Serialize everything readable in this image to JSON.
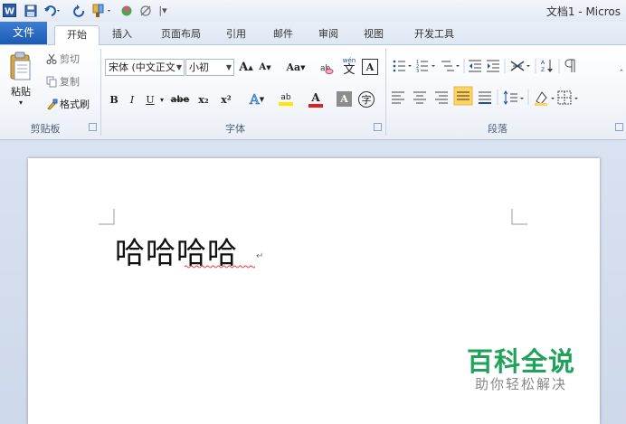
{
  "window": {
    "title": "文档1 - Micros"
  },
  "tabs": [
    "文件",
    "开始",
    "插入",
    "页面布局",
    "引用",
    "邮件",
    "审阅",
    "视图",
    "开发工具"
  ],
  "clipboard": {
    "paste_label": "粘贴",
    "cut_label": "剪切",
    "copy_label": "复制",
    "format_painter_label": "格式刷",
    "group_label": "剪贴板"
  },
  "font": {
    "font_name": "宋体 (中文正文",
    "font_size": "小初",
    "grow": "A",
    "shrink": "A",
    "change_case": "Aa",
    "clear_format": "☢",
    "pinyin": "wén",
    "bold": "B",
    "italic": "I",
    "underline": "U",
    "strikethrough": "abe",
    "subscript": "x₂",
    "superscript": "x²",
    "text_effect": "A",
    "highlight": "ab",
    "font_color": "A",
    "char_shading": "A",
    "enclose": "字",
    "group_label": "字体"
  },
  "paragraph": {
    "group_label": "段落"
  },
  "document": {
    "text": "哈哈哈哈"
  },
  "watermark": {
    "main": "百科全说",
    "sub": "助你轻松解决"
  },
  "colors": {
    "file_tab": "#2a6cc4",
    "watermark_green": "#1fa35b",
    "highlight_yellow": "#ffd35e",
    "font_color_red": "#e02020",
    "highlight_marker": "#ffe600"
  }
}
